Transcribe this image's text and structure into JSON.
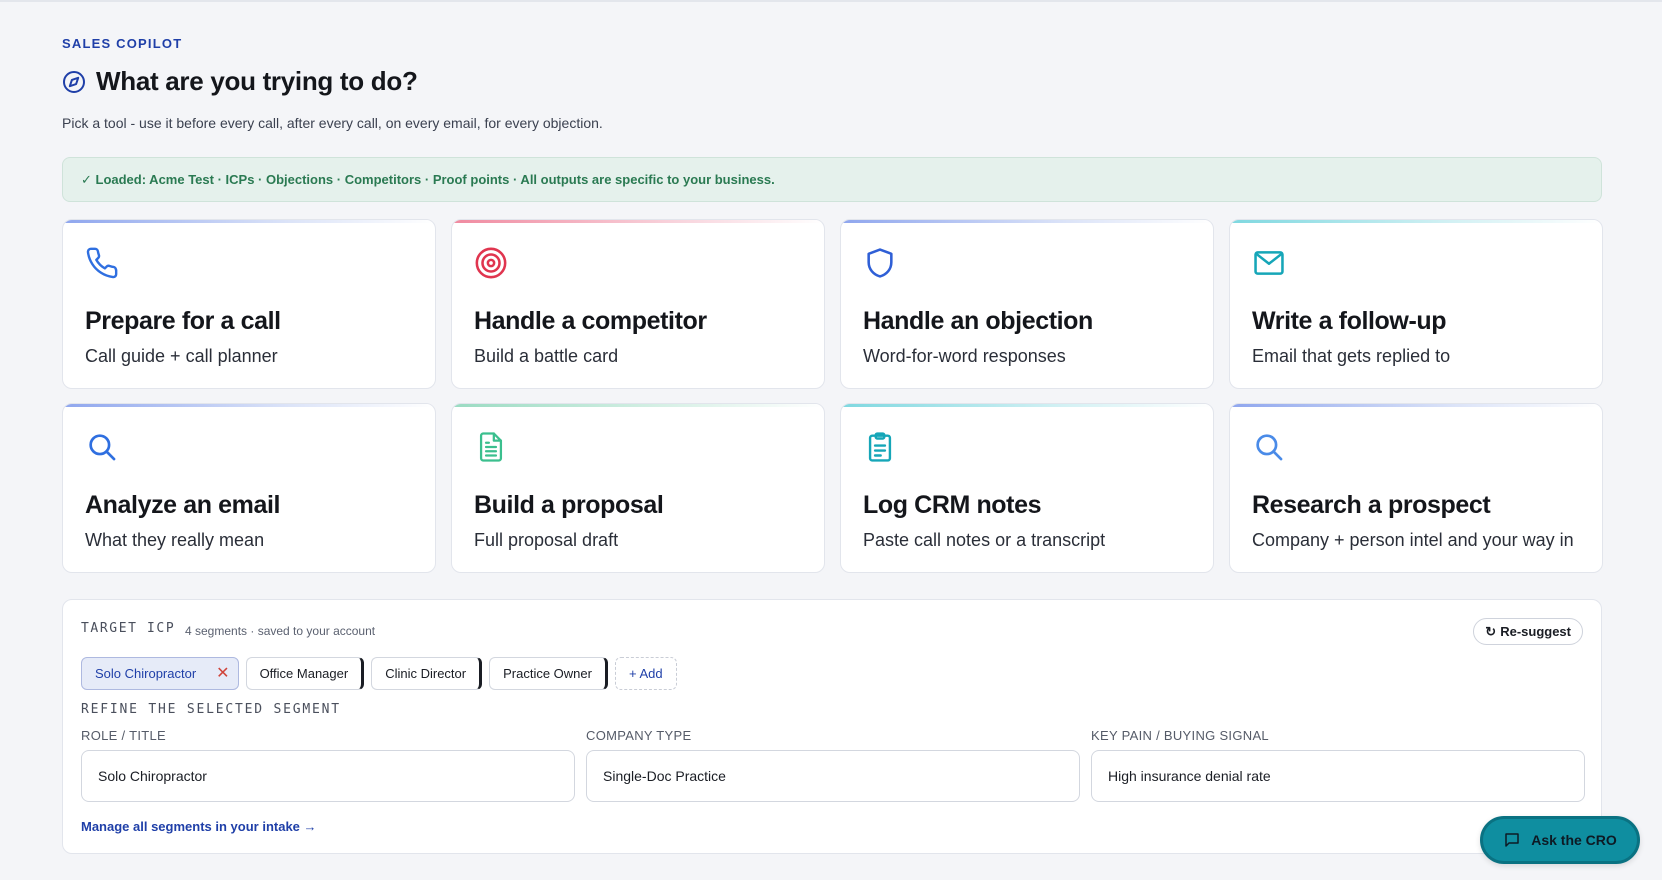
{
  "header": {
    "eyebrow": "SALES COPILOT",
    "title": "What are you trying to do?",
    "subtitle": "Pick a tool - use it before every call, after every call, on every email, for every objection."
  },
  "loaded_banner": "✓ Loaded: Acme Test · ICPs · Objections · Competitors · Proof points · All outputs are specific to your business.",
  "tools": [
    {
      "title": "Prepare for a call",
      "subtitle": "Call guide + call planner",
      "icon": "phone-icon",
      "color": "#2f6fe0"
    },
    {
      "title": "Handle a competitor",
      "subtitle": "Build a battle card",
      "icon": "target-icon",
      "color": "#e0354f"
    },
    {
      "title": "Handle an objection",
      "subtitle": "Word-for-word responses",
      "icon": "shield-icon",
      "color": "#2f5fd6"
    },
    {
      "title": "Write a follow-up",
      "subtitle": "Email that gets replied to",
      "icon": "mail-icon",
      "color": "#16a6b8"
    },
    {
      "title": "Analyze an email",
      "subtitle": "What they really mean",
      "icon": "search-icon",
      "color": "#2f6fe0"
    },
    {
      "title": "Build a proposal",
      "subtitle": "Full proposal draft",
      "icon": "document-icon",
      "color": "#3bbf8e"
    },
    {
      "title": "Log CRM notes",
      "subtitle": "Paste call notes or a transcript",
      "icon": "clipboard-icon",
      "color": "#16a6b8"
    },
    {
      "title": "Research a prospect",
      "subtitle": "Company + person intel and your way in",
      "icon": "search-icon",
      "color": "#4a8be8"
    }
  ],
  "icp": {
    "label": "TARGET ICP",
    "meta": "4 segments · saved to your account",
    "resuggest_label": "Re-suggest",
    "segments": [
      "Solo Chiropractor",
      "Office Manager",
      "Clinic Director",
      "Practice Owner"
    ],
    "add_label": "+ Add",
    "refine_label": "REFINE THE SELECTED SEGMENT",
    "fields": {
      "role": {
        "label": "ROLE / TITLE",
        "value": "Solo Chiropractor"
      },
      "company": {
        "label": "COMPANY TYPE",
        "value": "Single-Doc Practice"
      },
      "pain": {
        "label": "KEY PAIN / BUYING SIGNAL",
        "value": "High insurance denial rate"
      }
    },
    "manage_link": "Manage all segments in your intake →"
  },
  "cro_button": "Ask the CRO"
}
